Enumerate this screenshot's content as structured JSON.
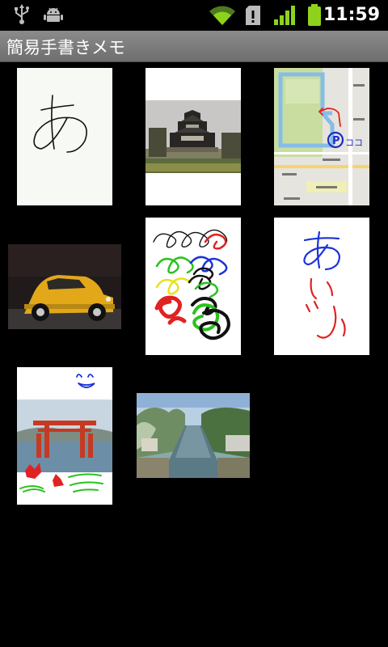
{
  "status_bar": {
    "time": "11:59",
    "icons": [
      "usb-icon",
      "android-debug-icon",
      "wifi-icon",
      "sd-card-alert-icon",
      "signal-icon",
      "battery-icon"
    ]
  },
  "title_bar": {
    "title": "簡易手書きメモ"
  },
  "memos": [
    {
      "kind": "handwriting",
      "text": "あ"
    },
    {
      "kind": "photo",
      "subject": "castle"
    },
    {
      "kind": "map",
      "labels": [
        "ココ",
        "P"
      ]
    },
    {
      "kind": "photo",
      "subject": "yellow-taxi"
    },
    {
      "kind": "handwriting",
      "subject": "colored-scribbles"
    },
    {
      "kind": "handwriting",
      "text": "ありがとう"
    },
    {
      "kind": "photo",
      "subject": "torii-gate-with-drawing"
    },
    {
      "kind": "photo",
      "subject": "canal"
    }
  ]
}
